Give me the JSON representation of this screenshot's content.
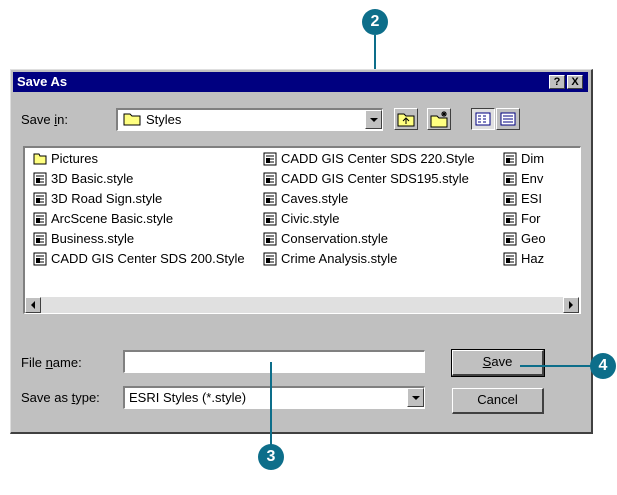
{
  "dialog": {
    "title": "Save As",
    "help_label": "?",
    "close_label": "X"
  },
  "save_in": {
    "label_prefix": "Save ",
    "label_ul": "i",
    "label_suffix": "n:",
    "value": "Styles"
  },
  "files": {
    "col1": [
      "Pictures",
      "3D Basic.style",
      "3D Road Sign.style",
      "ArcScene Basic.style",
      "Business.style",
      "CADD GIS Center SDS 200.Style"
    ],
    "col2": [
      "CADD GIS Center SDS 220.Style",
      "CADD GIS Center SDS195.style",
      "Caves.style",
      "Civic.style",
      "Conservation.style",
      "Crime Analysis.style"
    ],
    "col3": [
      "Dim",
      "Env",
      "ESI",
      "For",
      "Geo",
      "Haz"
    ]
  },
  "file_name": {
    "label_prefix": "File ",
    "label_ul": "n",
    "label_suffix": "ame:",
    "value": ""
  },
  "save_as_type": {
    "label_prefix": "Save as ",
    "label_ul": "t",
    "label_suffix": "ype:",
    "value": "ESRI Styles (*.style)"
  },
  "buttons": {
    "save_ul": "S",
    "save_rest": "ave",
    "cancel": "Cancel"
  },
  "callouts": {
    "c2": "2",
    "c3": "3",
    "c4": "4"
  },
  "colors": {
    "callout": "#0d6e8a",
    "titlebar": "#000080",
    "face": "#c0c0c0"
  }
}
